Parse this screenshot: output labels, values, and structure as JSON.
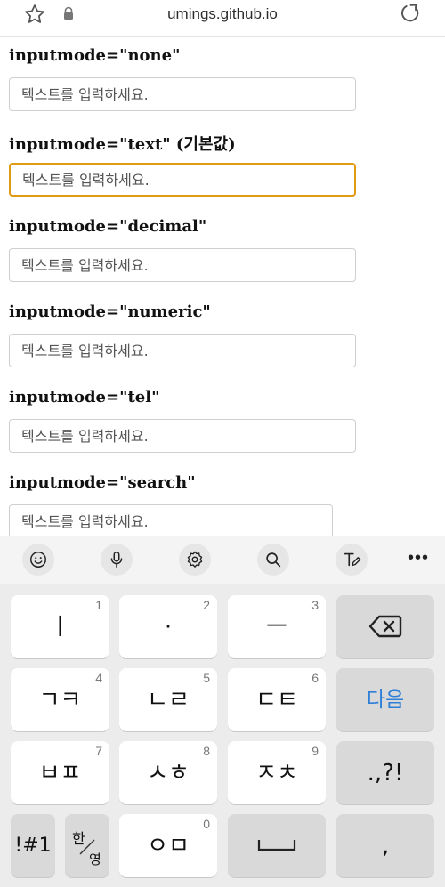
{
  "browser": {
    "url": "umings.github.io",
    "icons": {
      "bookmark": "star-icon",
      "secure": "lock-icon",
      "reload": "reload-icon"
    }
  },
  "fields": [
    {
      "label": "inputmode=\"none\"",
      "placeholder": "텍스트를 입력하세요.",
      "focused": false
    },
    {
      "label": "inputmode=\"text\" (기본값)",
      "placeholder": "텍스트를 입력하세요.",
      "focused": true
    },
    {
      "label": "inputmode=\"decimal\"",
      "placeholder": "텍스트를 입력하세요.",
      "focused": false
    },
    {
      "label": "inputmode=\"numeric\"",
      "placeholder": "텍스트를 입력하세요.",
      "focused": false
    },
    {
      "label": "inputmode=\"tel\"",
      "placeholder": "텍스트를 입력하세요.",
      "focused": false
    },
    {
      "label": "inputmode=\"search\"",
      "placeholder": "텍스트를 입력하세요.",
      "focused": false
    }
  ],
  "colors": {
    "focus_border": "#e09b14",
    "enter_key_text": "#2f7fd8"
  },
  "keyboard": {
    "toolbar": [
      "emoji-icon",
      "microphone-icon",
      "settings-icon",
      "search-icon",
      "handwriting-icon"
    ],
    "more_label": "•••",
    "keys": [
      {
        "label": "ㅣ",
        "hint": "1"
      },
      {
        "label": "·",
        "hint": "2"
      },
      {
        "label": "ㅡ",
        "hint": "3"
      },
      {
        "label": "",
        "hint": ""
      },
      {
        "label": "ㄱㅋ",
        "hint": "4"
      },
      {
        "label": "ㄴㄹ",
        "hint": "5"
      },
      {
        "label": "ㄷㅌ",
        "hint": "6"
      },
      {
        "label": "다음",
        "hint": ""
      },
      {
        "label": "ㅂㅍ",
        "hint": "7"
      },
      {
        "label": "ㅅㅎ",
        "hint": "8"
      },
      {
        "label": "ㅈㅊ",
        "hint": "9"
      },
      {
        "label": ".,?!",
        "hint": ""
      },
      {
        "label": "!#1",
        "hint": ""
      },
      {
        "label": "한",
        "hint": "영"
      },
      {
        "label": "ㅇㅁ",
        "hint": "0"
      },
      {
        "label": "",
        "hint": ""
      },
      {
        "label": ",",
        "hint": ""
      }
    ]
  }
}
